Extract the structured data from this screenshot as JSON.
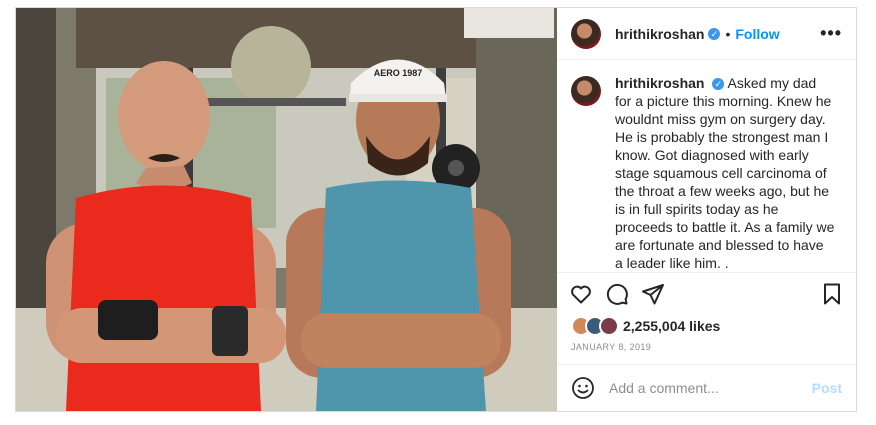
{
  "post": {
    "username": "hrithikroshan",
    "follow_label": "Follow",
    "dot": "•",
    "more": "•••",
    "caption": "Asked my dad for a picture this morning. Knew he wouldnt miss gym on surgery day. He is probably the strongest man I know. Got diagnosed with early stage squamous cell carcinoma of the throat a few weeks ago, but he is in full spirits today as he proceeds to battle it. As a family we are fortunate and blessed to have a leader like him. .\n\nLove you Dad.",
    "likes": "2,255,004 likes",
    "date": "JANUARY 8, 2019",
    "comment_placeholder": "Add a comment...",
    "post_label": "Post",
    "cap_text": "AERO 1987",
    "icons": {
      "like": "heart-icon",
      "comment": "comment-icon",
      "share": "share-icon",
      "save": "bookmark-icon",
      "emoji": "emoji-icon",
      "verified": "verified-badge-icon"
    },
    "colors": {
      "accent": "#0095f6",
      "verified": "#3897f0",
      "post_disabled": "#b2dffc"
    }
  }
}
